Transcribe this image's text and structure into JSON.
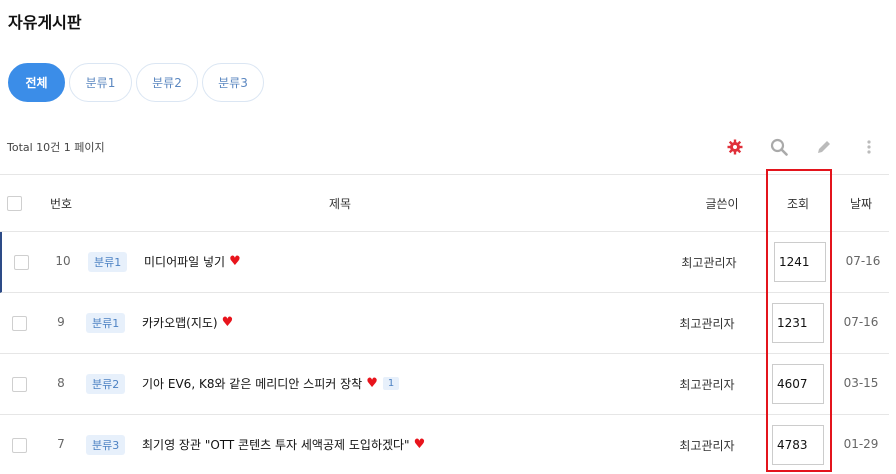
{
  "page": {
    "title": "자유게시판"
  },
  "categories": [
    {
      "label": "전체",
      "active": true
    },
    {
      "label": "분류1",
      "active": false
    },
    {
      "label": "분류2",
      "active": false
    },
    {
      "label": "분류3",
      "active": false
    }
  ],
  "summary": {
    "total_text": "Total 10건 1 페이지"
  },
  "toolbar": {
    "icons": [
      "gear-icon",
      "search-icon",
      "pencil-icon",
      "more-vertical-icon"
    ],
    "accent_color": "#e0303a"
  },
  "table": {
    "columns": {
      "num": "번호",
      "subject": "제목",
      "author": "글쓴이",
      "views": "조회",
      "date": "날짜"
    },
    "rows": [
      {
        "num": "10",
        "category": "분류1",
        "subject": "미디어파일 넣기",
        "comments": "",
        "author": "최고관리자",
        "views": "1241",
        "date": "07-16"
      },
      {
        "num": "9",
        "category": "분류1",
        "subject": "카카오맵(지도)",
        "comments": "",
        "author": "최고관리자",
        "views": "1231",
        "date": "07-16"
      },
      {
        "num": "8",
        "category": "분류2",
        "subject": "기아 EV6, K8와 같은 메리디안 스피커 장착",
        "comments": "1",
        "author": "최고관리자",
        "views": "4607",
        "date": "03-15"
      },
      {
        "num": "7",
        "category": "분류3",
        "subject": "최기영 장관 \"OTT 콘텐츠 투자 세액공제 도입하겠다\"",
        "comments": "",
        "author": "최고관리자",
        "views": "4783",
        "date": "01-29"
      }
    ]
  },
  "colors": {
    "primary": "#3b8de8",
    "highlight": "#e3141c",
    "heart": "#e8141c"
  }
}
